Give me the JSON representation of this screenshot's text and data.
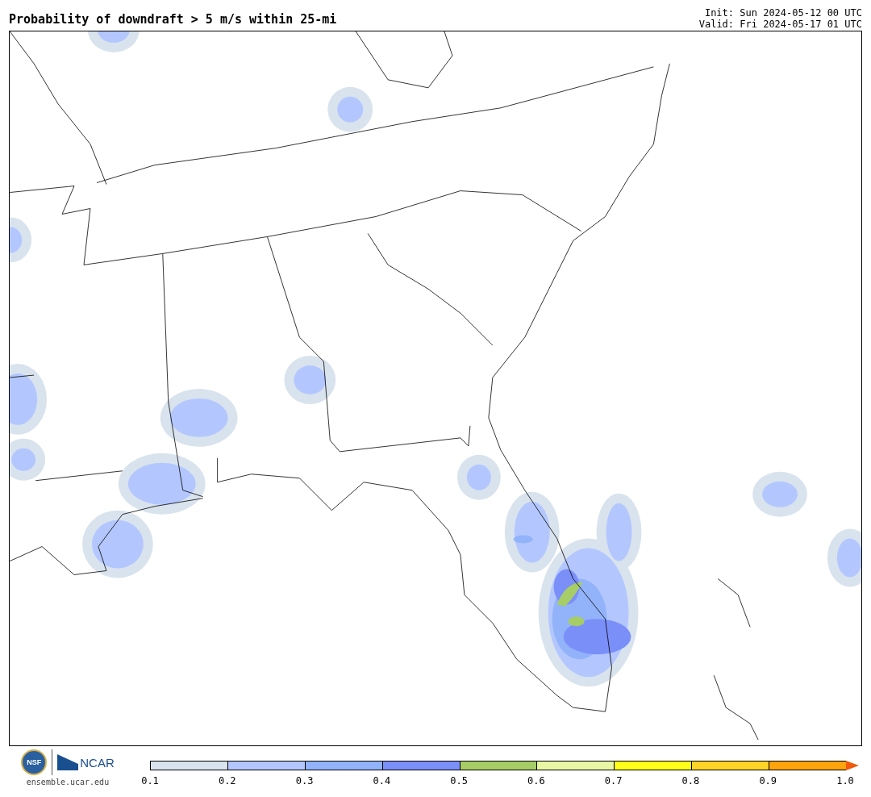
{
  "title": "Probability of downdraft > 5 m/s within 25-mi",
  "init": "Init: Sun 2024-05-12 00 UTC",
  "valid": "Valid: Fri 2024-05-17 01 UTC",
  "logos": {
    "nsf": "NSF",
    "ncar": "NCAR",
    "site": "ensemble.ucar.edu"
  },
  "colorbar": {
    "segments": [
      {
        "kind": "box",
        "color": "#d9e3ee"
      },
      {
        "kind": "box",
        "color": "#b3c7fe"
      },
      {
        "kind": "box",
        "color": "#92b3fa"
      },
      {
        "kind": "box",
        "color": "#7b8ff9"
      },
      {
        "kind": "box",
        "color": "#a7cd66"
      },
      {
        "kind": "box",
        "color": "#e9f6a4"
      },
      {
        "kind": "box",
        "color": "#ffff1a"
      },
      {
        "kind": "box",
        "color": "#fed428"
      },
      {
        "kind": "box",
        "color": "#fea40d"
      },
      {
        "kind": "arrow",
        "color": "#f05a0a"
      }
    ],
    "ticks": [
      "0.1",
      "0.2",
      "0.3",
      "0.4",
      "0.5",
      "0.6",
      "0.7",
      "0.8",
      "0.9",
      "1.0"
    ]
  }
}
